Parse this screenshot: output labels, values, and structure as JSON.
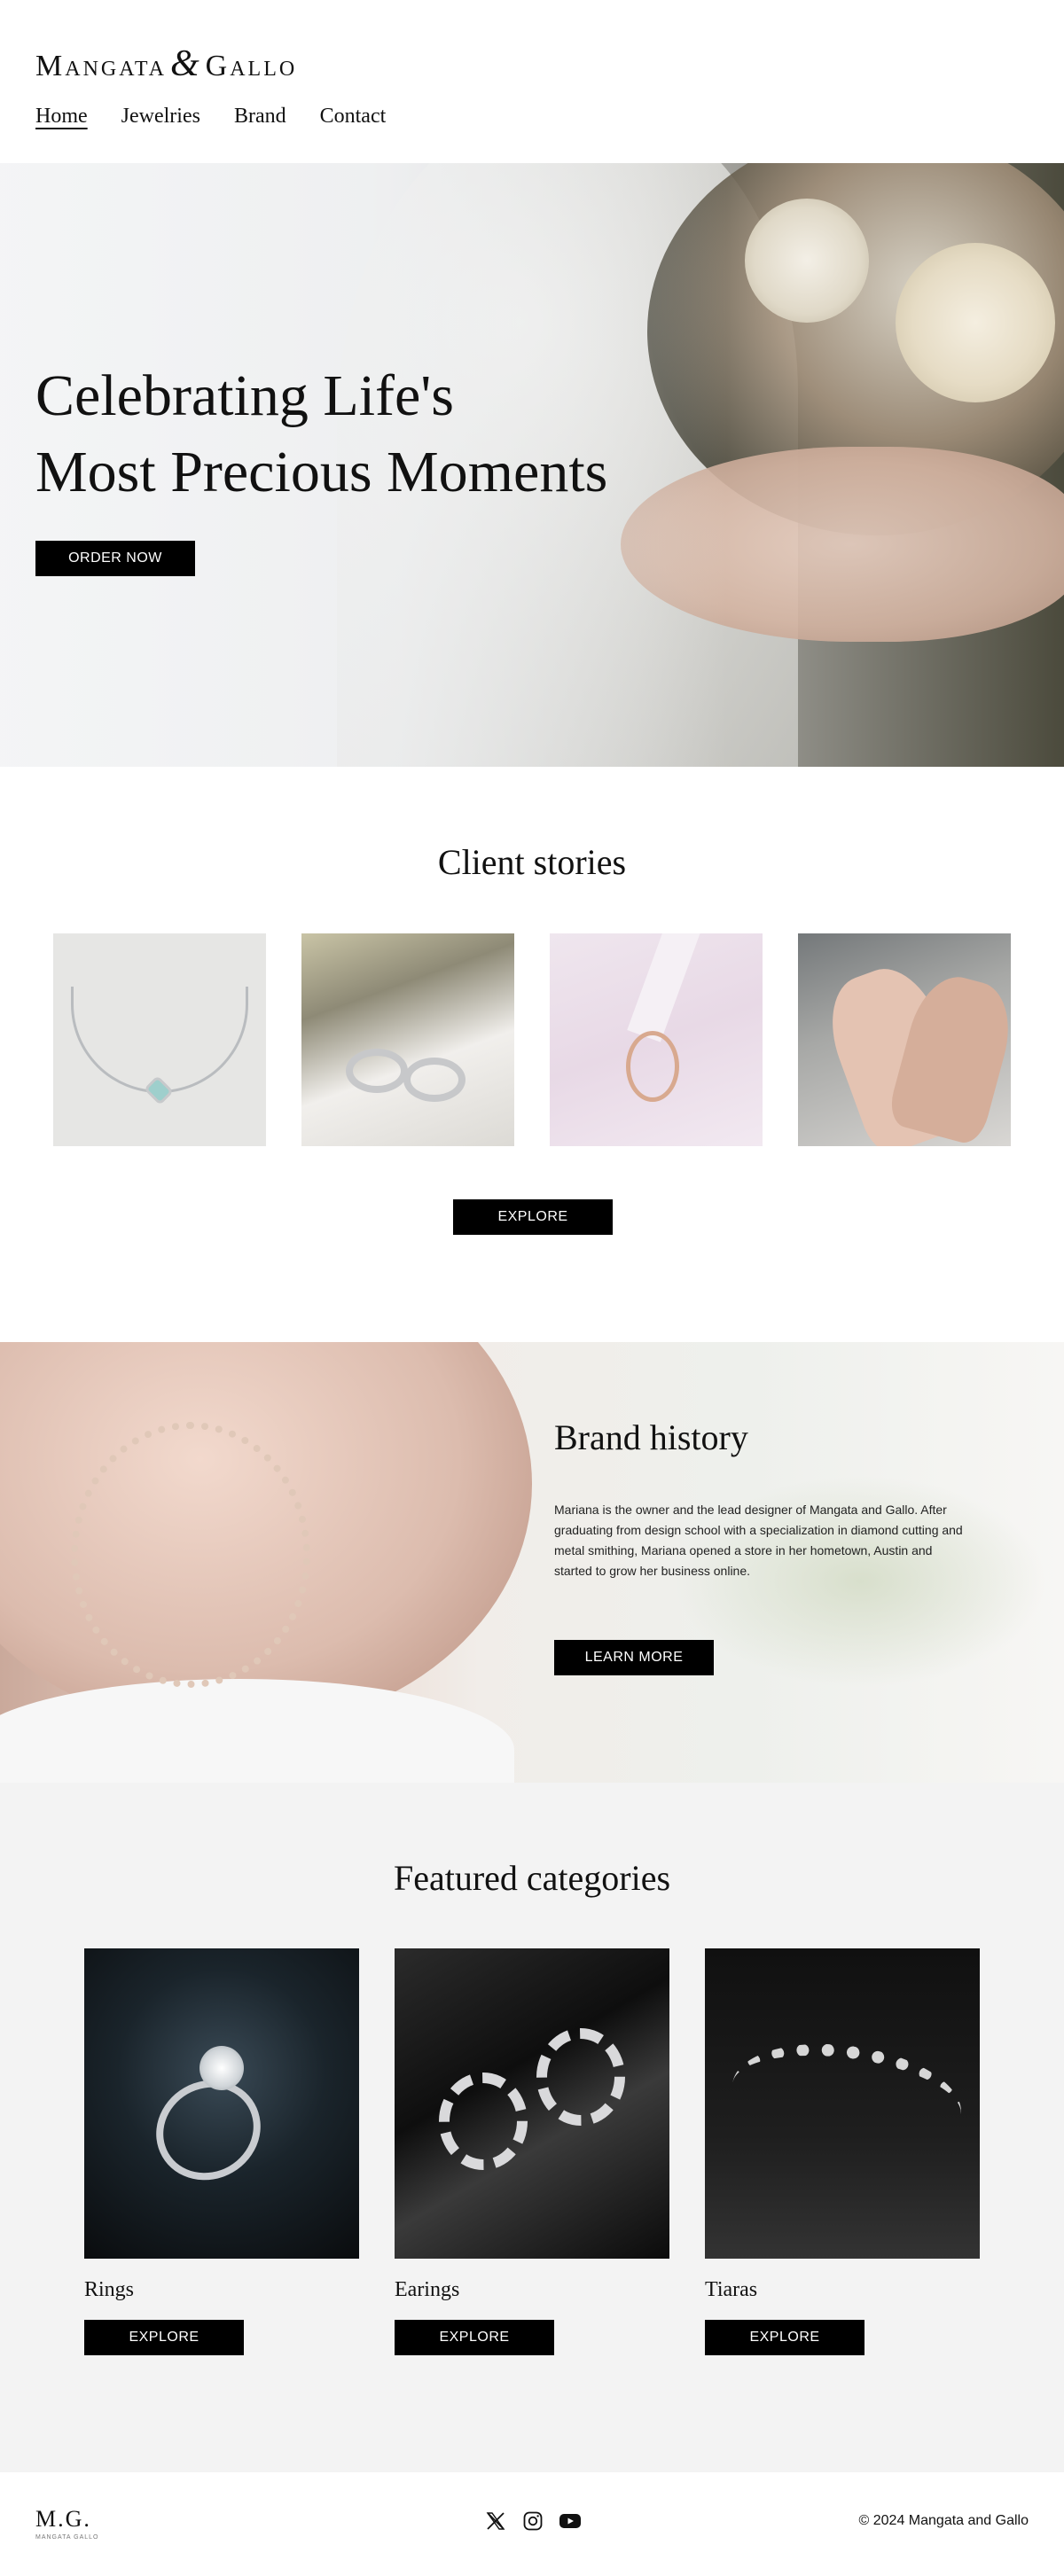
{
  "brand": {
    "logo_first": "Mangata",
    "logo_amp": "&",
    "logo_second": "Gallo"
  },
  "nav": {
    "items": [
      {
        "label": "Home",
        "active": true
      },
      {
        "label": "Jewelries",
        "active": false
      },
      {
        "label": "Brand",
        "active": false
      },
      {
        "label": "Contact",
        "active": false
      }
    ]
  },
  "hero": {
    "title_line1": "Celebrating Life's",
    "title_line2": "Most Precious Moments",
    "cta": "ORDER NOW"
  },
  "stories": {
    "title": "Client stories",
    "cta": "EXPLORE"
  },
  "history": {
    "title": "Brand history",
    "text": "Mariana is the owner and the lead designer of Mangata and Gallo. After graduating from design school with a specialization in diamond cutting and metal smithing, Mariana opened a store in her hometown, Austin and started to grow her business online.",
    "cta": "LEARN MORE"
  },
  "featured": {
    "title": "Featured categories",
    "categories": [
      {
        "name": "Rings",
        "cta": "EXPLORE"
      },
      {
        "name": "Earings",
        "cta": "EXPLORE"
      },
      {
        "name": "Tiaras",
        "cta": "EXPLORE"
      }
    ]
  },
  "footer": {
    "logo": "M.G.",
    "logo_sub": "MANGATA GALLO",
    "socials": [
      "x-icon",
      "instagram-icon",
      "youtube-icon"
    ],
    "copyright": "© 2024  Mangata and Gallo"
  },
  "colors": {
    "button_bg": "#000000",
    "button_text": "#ffffff",
    "featured_bg": "#f3f3f3"
  }
}
